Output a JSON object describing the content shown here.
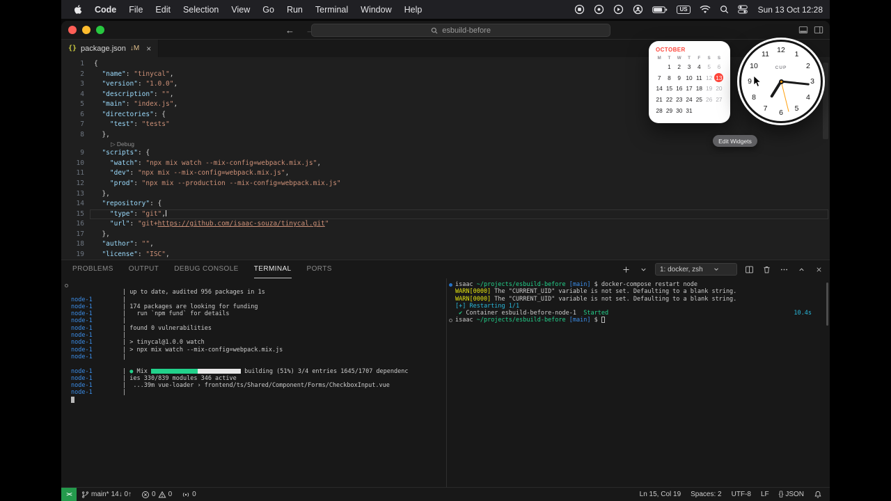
{
  "colors": {
    "editor_bg": "#1f1f1f",
    "panel_bg": "#181818",
    "menubar_bg": "#202024",
    "json_key": "#9cdcfe",
    "json_string": "#ce9178",
    "git_modified_badge": "#e2c08d",
    "terminal_node_prefix": "#3b8eea",
    "terminal_green": "#23d18b",
    "terminal_yellow": "#e5e510",
    "terminal_cyan": "#29b8db",
    "remote_indicator_green": "#249a4c",
    "calendar_accent_red": "#ff453a",
    "traffic_red": "#ff5f57",
    "traffic_yellow": "#febc2e",
    "traffic_green": "#28c840"
  },
  "menubar": {
    "menus": [
      "Code",
      "File",
      "Edit",
      "Selection",
      "View",
      "Go",
      "Run",
      "Terminal",
      "Window",
      "Help"
    ],
    "input_source": "US",
    "clock": "Sun 13 Oct 12:28"
  },
  "titlebar": {
    "search_value": "esbuild-before",
    "back_glyph": "←",
    "forward_glyph": "→"
  },
  "tab": {
    "icon": "{}",
    "label": "package.json",
    "badge": "↓M",
    "close": "×"
  },
  "editor": {
    "cursor_line": 15,
    "lines": [
      {
        "n": "1",
        "t": [
          {
            "t": "{",
            "c": "p"
          }
        ]
      },
      {
        "n": "2",
        "t": [
          {
            "t": "  ",
            "c": "p"
          },
          {
            "t": "\"name\"",
            "c": "k"
          },
          {
            "t": ": ",
            "c": "p"
          },
          {
            "t": "\"tinycal\"",
            "c": "s"
          },
          {
            "t": ",",
            "c": "p"
          }
        ]
      },
      {
        "n": "3",
        "t": [
          {
            "t": "  ",
            "c": "p"
          },
          {
            "t": "\"version\"",
            "c": "k"
          },
          {
            "t": ": ",
            "c": "p"
          },
          {
            "t": "\"1.0.0\"",
            "c": "s"
          },
          {
            "t": ",",
            "c": "p"
          }
        ]
      },
      {
        "n": "4",
        "t": [
          {
            "t": "  ",
            "c": "p"
          },
          {
            "t": "\"description\"",
            "c": "k"
          },
          {
            "t": ": ",
            "c": "p"
          },
          {
            "t": "\"\"",
            "c": "s"
          },
          {
            "t": ",",
            "c": "p"
          }
        ]
      },
      {
        "n": "5",
        "t": [
          {
            "t": "  ",
            "c": "p"
          },
          {
            "t": "\"main\"",
            "c": "k"
          },
          {
            "t": ": ",
            "c": "p"
          },
          {
            "t": "\"index.js\"",
            "c": "s"
          },
          {
            "t": ",",
            "c": "p"
          }
        ]
      },
      {
        "n": "6",
        "t": [
          {
            "t": "  ",
            "c": "p"
          },
          {
            "t": "\"directories\"",
            "c": "k"
          },
          {
            "t": ": {",
            "c": "p"
          }
        ]
      },
      {
        "n": "7",
        "t": [
          {
            "t": "    ",
            "c": "p"
          },
          {
            "t": "\"test\"",
            "c": "k"
          },
          {
            "t": ": ",
            "c": "p"
          },
          {
            "t": "\"tests\"",
            "c": "s"
          }
        ]
      },
      {
        "n": "8",
        "t": [
          {
            "t": "  },",
            "c": "p"
          }
        ]
      },
      {
        "lens": "▷ Debug"
      },
      {
        "n": "9",
        "t": [
          {
            "t": "  ",
            "c": "p"
          },
          {
            "t": "\"scripts\"",
            "c": "k"
          },
          {
            "t": ": {",
            "c": "p"
          }
        ]
      },
      {
        "n": "10",
        "t": [
          {
            "t": "    ",
            "c": "p"
          },
          {
            "t": "\"watch\"",
            "c": "k"
          },
          {
            "t": ": ",
            "c": "p"
          },
          {
            "t": "\"npx mix watch --mix-config=webpack.mix.js\"",
            "c": "s"
          },
          {
            "t": ",",
            "c": "p"
          }
        ]
      },
      {
        "n": "11",
        "t": [
          {
            "t": "    ",
            "c": "p"
          },
          {
            "t": "\"dev\"",
            "c": "k"
          },
          {
            "t": ": ",
            "c": "p"
          },
          {
            "t": "\"npx mix --mix-config=webpack.mix.js\"",
            "c": "s"
          },
          {
            "t": ",",
            "c": "p"
          }
        ]
      },
      {
        "n": "12",
        "t": [
          {
            "t": "    ",
            "c": "p"
          },
          {
            "t": "\"prod\"",
            "c": "k"
          },
          {
            "t": ": ",
            "c": "p"
          },
          {
            "t": "\"npx mix --production --mix-config=webpack.mix.js\"",
            "c": "s"
          }
        ]
      },
      {
        "n": "13",
        "t": [
          {
            "t": "  },",
            "c": "p"
          }
        ]
      },
      {
        "n": "14",
        "t": [
          {
            "t": "  ",
            "c": "p"
          },
          {
            "t": "\"repository\"",
            "c": "k"
          },
          {
            "t": ": {",
            "c": "p"
          }
        ]
      },
      {
        "n": "15",
        "cur": true,
        "t": [
          {
            "t": "    ",
            "c": "p"
          },
          {
            "t": "\"type\"",
            "c": "k"
          },
          {
            "t": ": ",
            "c": "p"
          },
          {
            "t": "\"git\"",
            "c": "s"
          },
          {
            "t": ",",
            "c": "p"
          }
        ]
      },
      {
        "n": "16",
        "t": [
          {
            "t": "    ",
            "c": "p"
          },
          {
            "t": "\"url\"",
            "c": "k"
          },
          {
            "t": ": ",
            "c": "p"
          },
          {
            "t": "\"git+",
            "c": "s"
          },
          {
            "t": "https://github.com/isaac-souza/tinycal.git",
            "c": "l"
          },
          {
            "t": "\"",
            "c": "s"
          }
        ]
      },
      {
        "n": "17",
        "t": [
          {
            "t": "  },",
            "c": "p"
          }
        ]
      },
      {
        "n": "18",
        "t": [
          {
            "t": "  ",
            "c": "p"
          },
          {
            "t": "\"author\"",
            "c": "k"
          },
          {
            "t": ": ",
            "c": "p"
          },
          {
            "t": "\"\"",
            "c": "s"
          },
          {
            "t": ",",
            "c": "p"
          }
        ]
      },
      {
        "n": "19",
        "t": [
          {
            "t": "  ",
            "c": "p"
          },
          {
            "t": "\"license\"",
            "c": "k"
          },
          {
            "t": ": ",
            "c": "p"
          },
          {
            "t": "\"ISC\"",
            "c": "s"
          },
          {
            "t": ",",
            "c": "p"
          }
        ]
      }
    ]
  },
  "panel": {
    "tabs": [
      "PROBLEMS",
      "OUTPUT",
      "DEBUG CONSOLE",
      "TERMINAL",
      "PORTS"
    ],
    "active_tab": "TERMINAL",
    "terminal_selector": "1: docker, zsh",
    "terminal_left": [
      {
        "dec": "gray",
        "t": []
      },
      {
        "p": "",
        "s": "|",
        "t": [
          {
            "t": " up to date, audited 956 packages in 1s",
            "c": "t"
          }
        ]
      },
      {
        "p": "node-1",
        "s": "|",
        "t": []
      },
      {
        "p": "node-1",
        "s": "|",
        "t": [
          {
            "t": " 174 packages are looking for funding",
            "c": "t"
          }
        ]
      },
      {
        "p": "node-1",
        "s": "|",
        "t": [
          {
            "t": "   run `npm fund` for details",
            "c": "t"
          }
        ]
      },
      {
        "p": "node-1",
        "s": "|",
        "t": []
      },
      {
        "p": "node-1",
        "s": "|",
        "t": [
          {
            "t": " found 0 vulnerabilities",
            "c": "t"
          }
        ]
      },
      {
        "p": "node-1",
        "s": "|",
        "t": []
      },
      {
        "p": "node-1",
        "s": "|",
        "t": [
          {
            "t": " > tinycal@1.0.0 watch",
            "c": "t"
          }
        ]
      },
      {
        "p": "node-1",
        "s": "|",
        "t": [
          {
            "t": " > npx mix watch --mix-config=webpack.mix.js",
            "c": "t"
          }
        ]
      },
      {
        "p": "node-1",
        "s": "|",
        "t": []
      },
      {
        "t": []
      },
      {
        "p": "node-1",
        "s": "|",
        "t": [
          {
            "t": " ",
            "c": "t"
          },
          {
            "t": "●",
            "c": "grn"
          },
          {
            "t": " Mix ",
            "c": "t"
          },
          {
            "c": "bar-g"
          },
          {
            "c": "bar-w"
          },
          {
            "t": " building (51%) 3/4 entries 1645/1707 dependenc",
            "c": "t"
          }
        ]
      },
      {
        "p": "node-1",
        "s": "|",
        "t": [
          {
            "t": " ies 330/839 modules 346 active",
            "c": "t"
          }
        ]
      },
      {
        "p": "node-1",
        "s": "|",
        "t": [
          {
            "t": "  ...39m vue-loader › frontend/ts/Shared/Component/Forms/CheckboxInput.vue",
            "c": "t"
          }
        ]
      },
      {
        "p": "node-1",
        "s": "|",
        "t": []
      },
      {
        "cursor": "block"
      }
    ],
    "terminal_right": [
      {
        "dec": "blue",
        "t": [
          {
            "t": "isaac ",
            "c": "t"
          },
          {
            "t": "~/projects/esbuild-before ",
            "c": "grn"
          },
          {
            "t": "[main]",
            "c": "blu"
          },
          {
            "t": " $ ",
            "c": "t"
          },
          {
            "t": "docker-compose restart node",
            "c": "t"
          }
        ]
      },
      {
        "t": [
          {
            "t": "WARN[0000]",
            "c": "yel"
          },
          {
            "t": " The \"CURRENT_UID\" variable is not set. Defaulting to a blank string.",
            "c": "t"
          }
        ]
      },
      {
        "t": [
          {
            "t": "WARN[0000]",
            "c": "yel"
          },
          {
            "t": " The \"CURRENT_UID\" variable is not set. Defaulting to a blank string.",
            "c": "t"
          }
        ]
      },
      {
        "t": [
          {
            "t": "[+] Restarting 1/1",
            "c": "cyn"
          }
        ]
      },
      {
        "t": [
          {
            "t": " ",
            "c": "t"
          },
          {
            "t": "✔",
            "c": "grn"
          },
          {
            "t": " Container esbuild-before-node-1  ",
            "c": "t"
          },
          {
            "t": "Started",
            "c": "grn"
          }
        ],
        "right": {
          "t": "10.4s",
          "c": "cyn"
        }
      },
      {
        "dec": "gray",
        "cursorAfter": true,
        "t": [
          {
            "t": "isaac ",
            "c": "t"
          },
          {
            "t": "~/projects/esbuild-before ",
            "c": "grn"
          },
          {
            "t": "[main]",
            "c": "blu"
          },
          {
            "t": " $ ",
            "c": "t"
          }
        ],
        "cursor": "hollow"
      }
    ]
  },
  "statusbar": {
    "remote_glyph": "><",
    "branch": "main*",
    "sync": "14↓ 0↑",
    "errors": "0",
    "warnings": "0",
    "ports": "0",
    "line_col": "Ln 15, Col 19",
    "indentation": "Spaces: 2",
    "encoding": "UTF-8",
    "eol": "LF",
    "language_braces": "{}",
    "language": "JSON"
  },
  "widgets": {
    "calendar": {
      "month": "OCTOBER",
      "day_headers": [
        "M",
        "T",
        "W",
        "T",
        "F",
        "S",
        "S"
      ],
      "weeks": [
        [
          "",
          "1",
          "2",
          "3",
          "4",
          "5",
          "6"
        ],
        [
          "7",
          "8",
          "9",
          "10",
          "11",
          "12",
          "13"
        ],
        [
          "14",
          "15",
          "16",
          "17",
          "18",
          "19",
          "20"
        ],
        [
          "21",
          "22",
          "23",
          "24",
          "25",
          "26",
          "27"
        ],
        [
          "28",
          "29",
          "30",
          "31",
          "",
          "",
          ""
        ]
      ],
      "today": "13"
    },
    "clock": {
      "label": "CUP",
      "numbers": [
        "12",
        "1",
        "2",
        "3",
        "4",
        "5",
        "6",
        "7",
        "8",
        "9",
        "10",
        "11"
      ],
      "hands": {
        "hour_deg": 212,
        "minute_deg": 96,
        "second_deg": 166
      }
    },
    "edit_widgets_label": "Edit Widgets"
  }
}
